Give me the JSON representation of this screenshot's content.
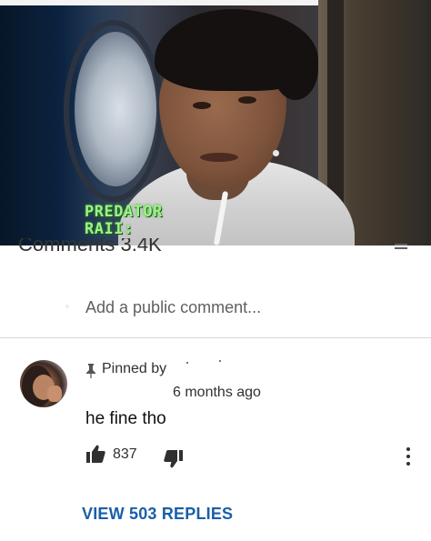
{
  "video": {
    "caption_line1": "PREDATOR",
    "caption_line2": "RAII:",
    "caption_color": "#9ff08a"
  },
  "comments": {
    "header_partial": "Comments 3.4K"
  },
  "add_comment": {
    "placeholder": "Add a public comment..."
  },
  "comment": {
    "pinned_label": "Pinned by",
    "pinned_icon": "pin-icon",
    "time": "6 months ago",
    "text": "he fine tho",
    "likes": "837",
    "like_icon": "thumbs-up-icon",
    "dislike_icon": "thumbs-down-icon",
    "more_icon": "more-vertical-icon",
    "view_replies": "VIEW 503 REPLIES"
  },
  "colors": {
    "link": "#1a5fa8",
    "text": "#111111",
    "secondary": "#606060"
  }
}
